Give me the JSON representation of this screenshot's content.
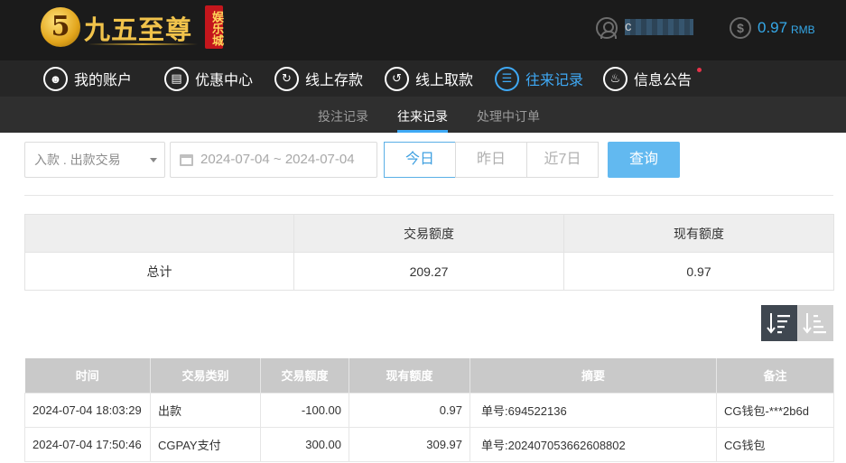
{
  "header": {
    "logo_number": "5",
    "logo_text": "九五至尊",
    "logo_sub": "娱乐城",
    "username": "c",
    "balance": "0.97",
    "balance_unit": "RMB"
  },
  "nav": {
    "items": [
      {
        "label": "我的账户",
        "icon": "user-icon",
        "active": false
      },
      {
        "label": "优惠中心",
        "icon": "gift-icon",
        "active": false
      },
      {
        "label": "线上存款",
        "icon": "deposit-icon",
        "active": false
      },
      {
        "label": "线上取款",
        "icon": "withdraw-icon",
        "active": false
      },
      {
        "label": "往来记录",
        "icon": "records-icon",
        "active": true
      },
      {
        "label": "信息公告",
        "icon": "bell-icon",
        "active": false
      }
    ]
  },
  "subtabs": {
    "items": [
      "投注记录",
      "往来记录",
      "处理中订单"
    ],
    "active_index": 1
  },
  "filters": {
    "type_select": "入款 . 出款交易",
    "date_range": "2024-07-04 ~ 2024-07-04",
    "quick_ranges": [
      "今日",
      "昨日",
      "近7日"
    ],
    "active_range": 0,
    "query_label": "查询"
  },
  "summary": {
    "headers": [
      "",
      "交易额度",
      "现有额度"
    ],
    "row": [
      "总计",
      "209.27",
      "0.97"
    ]
  },
  "records": {
    "headers": [
      "时间",
      "交易类别",
      "交易额度",
      "现有额度",
      "摘要",
      "备注"
    ],
    "rows": [
      [
        "2024-07-04 18:03:29",
        "出款",
        "-100.00",
        "0.97",
        "单号:694522136",
        "CG钱包-***2b6d"
      ],
      [
        "2024-07-04 17:50:46",
        "CGPAY支付",
        "300.00",
        "309.97",
        "单号:202407053662608802",
        "CG钱包"
      ]
    ]
  },
  "colors": {
    "accent": "#3fa9f5",
    "header_bg": "#1b1b1b",
    "nav_bg": "#262626",
    "query_btn": "#62b9f0"
  }
}
